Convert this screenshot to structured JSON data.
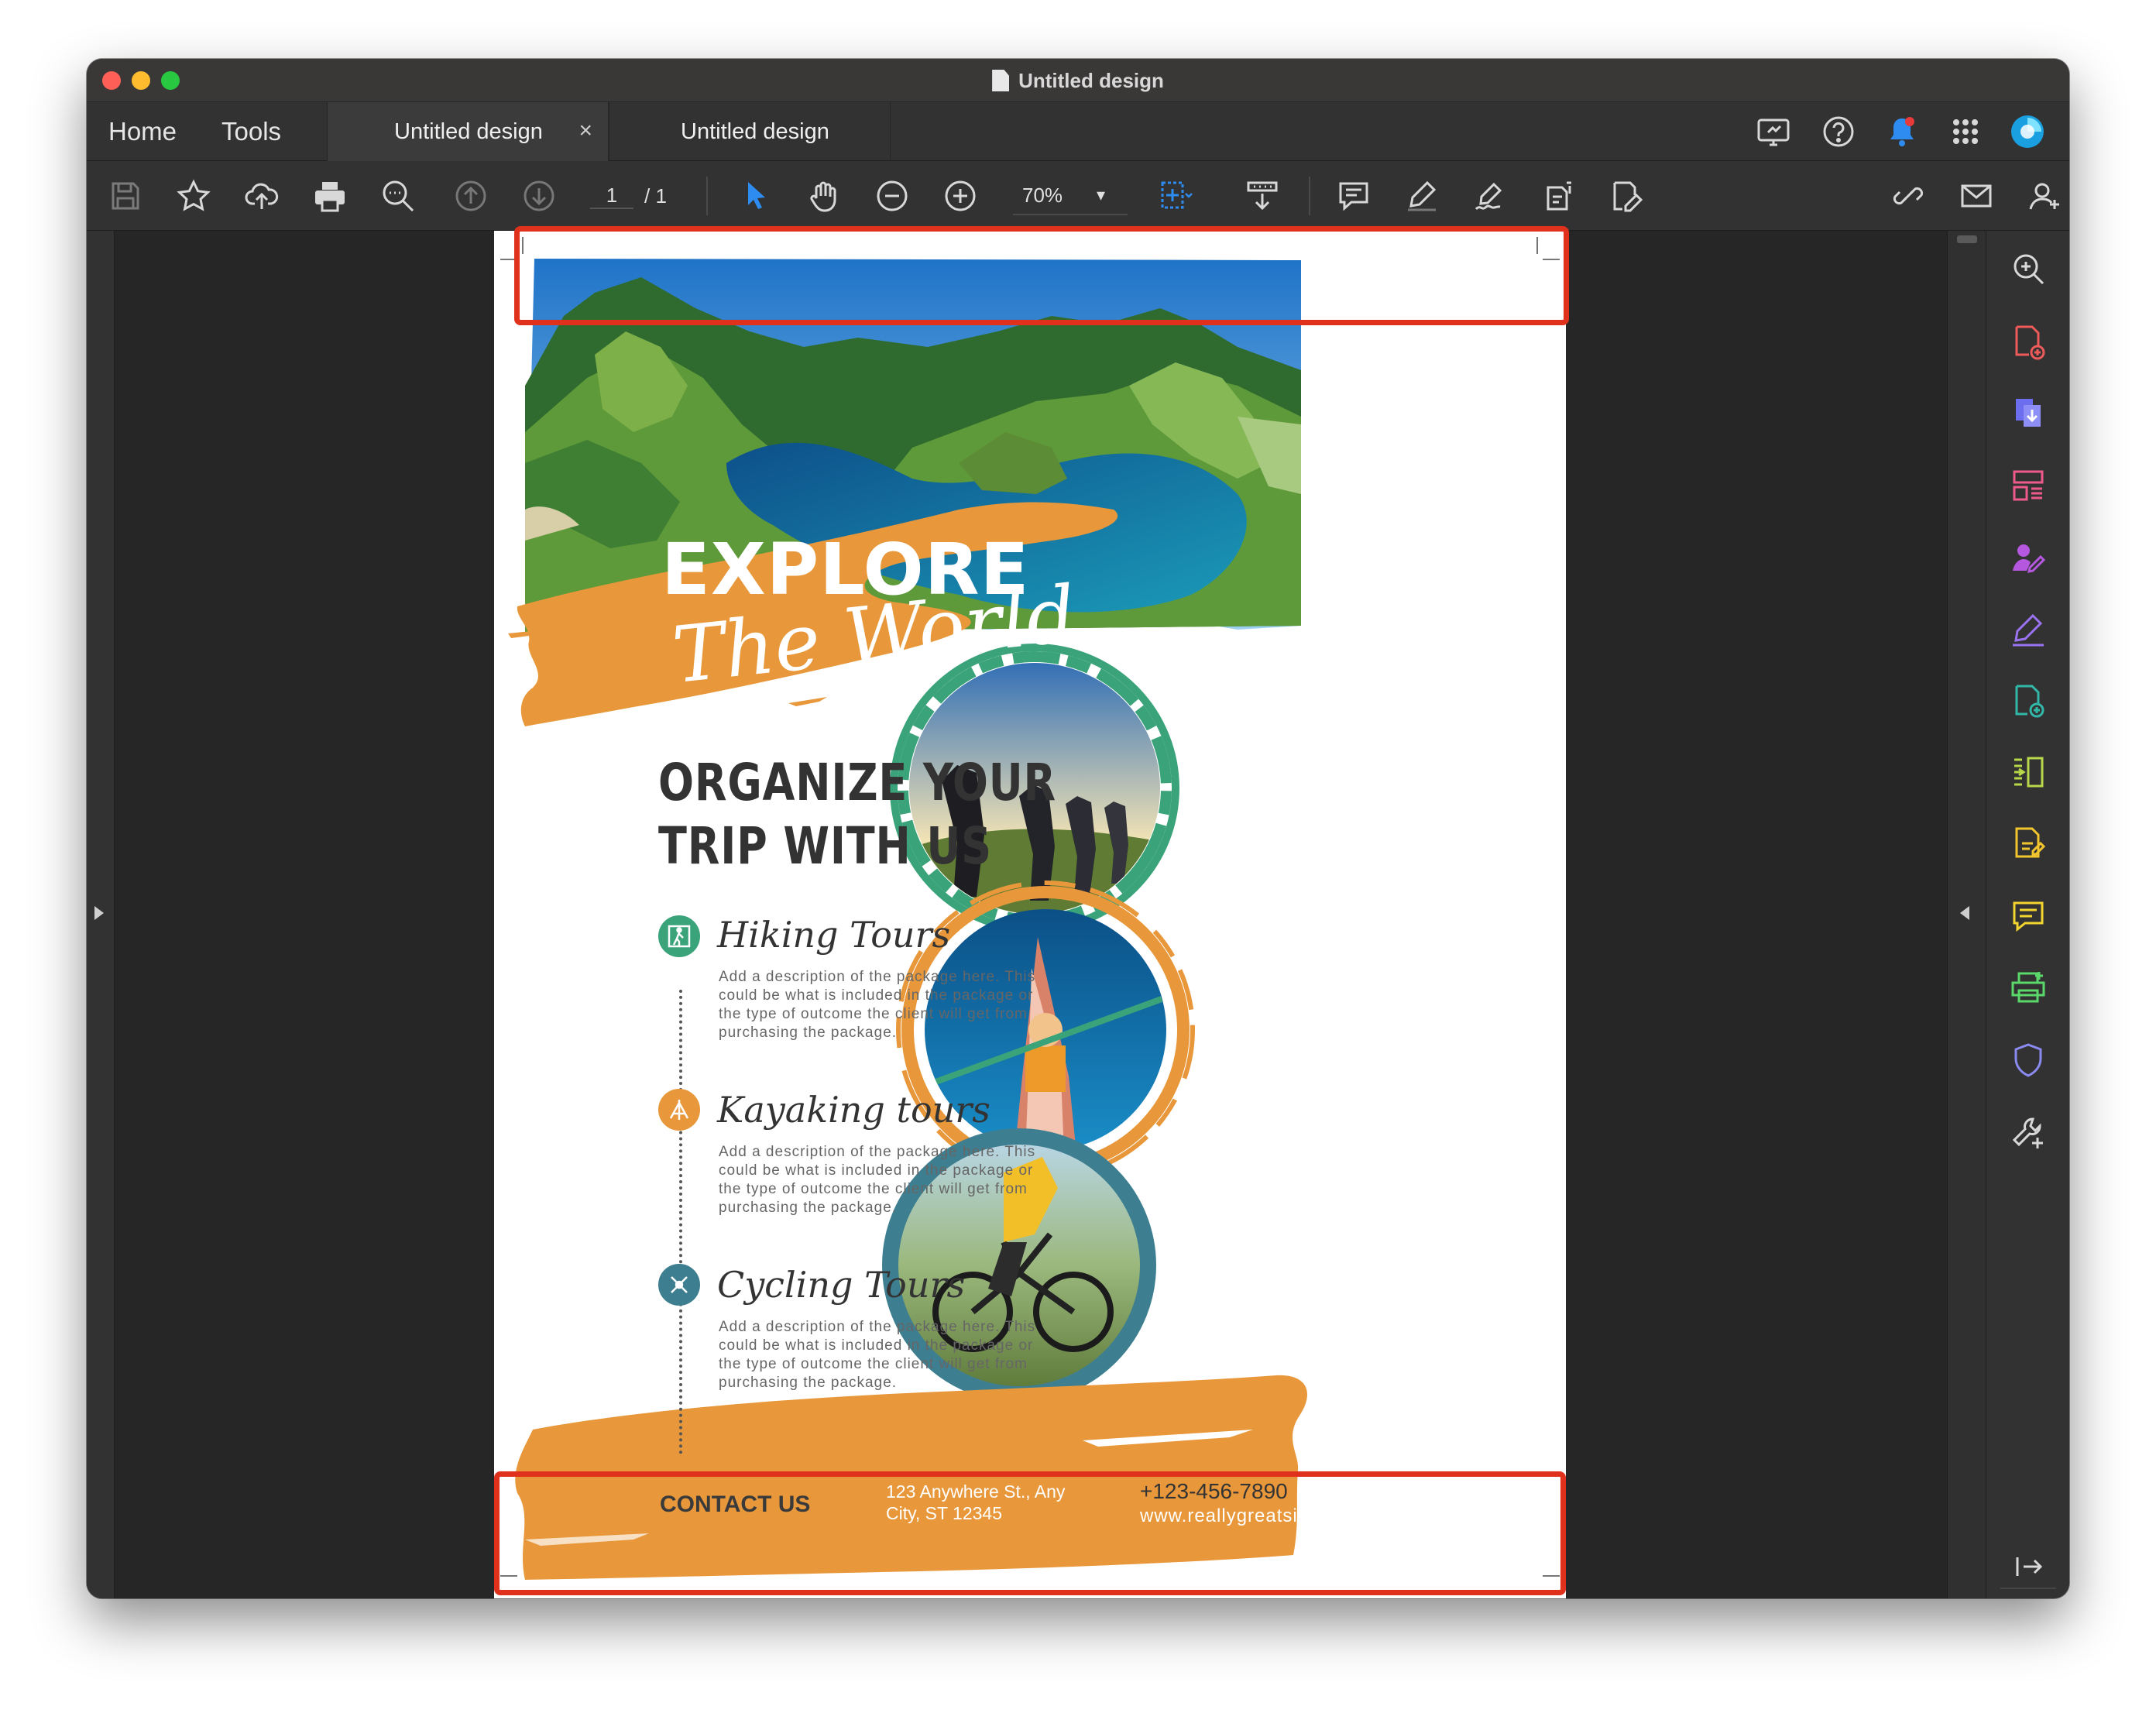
{
  "window": {
    "title": "Untitled design"
  },
  "nav": {
    "home": "Home",
    "tools": "Tools"
  },
  "tabs": [
    {
      "label": "Untitled design",
      "close": "×"
    },
    {
      "label": "Untitled design"
    }
  ],
  "toolbar": {
    "page_current": "1",
    "page_total": "/ 1",
    "zoom": "70%",
    "zoom_chevron": "▾"
  },
  "accent": {
    "orange": "#e8983b",
    "teal": "#3aa37a",
    "blue_teal": "#3d7f90",
    "highlight_red": "#e0311d"
  },
  "icons": {
    "tabbar_right": [
      "screen-share-icon",
      "help-icon",
      "notification-bell-icon",
      "apps-grid-icon",
      "profile-avatar-icon"
    ],
    "toolbar": [
      "save-icon",
      "bookmark-star-icon",
      "cloud-upload-icon",
      "print-icon",
      "zoom-search-icon",
      "page-up-icon",
      "page-down-icon",
      "select-cursor-icon",
      "hand-pan-icon",
      "zoom-out-icon",
      "zoom-in-icon",
      "fit-page-icon",
      "scroll-mode-icon",
      "comment-icon",
      "highlight-pen-icon",
      "sign-icon",
      "rotate-page-icon",
      "edit-pdf-icon",
      "share-link-icon",
      "email-icon",
      "add-user-icon"
    ],
    "right_panel": [
      "search-zoom-icon",
      "create-pdf-icon",
      "export-pdf-icon",
      "organize-pages-icon",
      "request-signature-icon",
      "fill-sign-icon",
      "combine-files-icon",
      "compress-pdf-icon",
      "edit-pdf-icon",
      "comment-icon",
      "scan-ocr-icon",
      "protect-icon",
      "more-tools-icon",
      "collapse-panel-icon"
    ]
  },
  "flyer": {
    "explore": "EXPLORE",
    "the_world": "The World",
    "headline_1": "ORGANIZE YOUR",
    "headline_2": "TRIP WITH US",
    "tours": [
      {
        "title": "Hiking Tours",
        "desc": "Add a description of the package here. This could be what is included in the package or the type of outcome the client will get from purchasing the package.",
        "color": "#3aa37a"
      },
      {
        "title": "Kayaking tours",
        "desc": "Add a description of the package here. This could be what is included in the package or the type of outcome the client will get from purchasing the package.",
        "color": "#e8983b"
      },
      {
        "title": "Cycling Tours",
        "desc": "Add a description of the package here. This could be what is included in the package or the type of outcome the client will get from purchasing the package.",
        "color": "#3d7f90"
      }
    ],
    "contact": {
      "label": "CONTACT US",
      "address": "123 Anywhere St., Any City, ST 12345",
      "phone": "+123-456-7890",
      "website": "www.reallygreatsite.com"
    }
  }
}
